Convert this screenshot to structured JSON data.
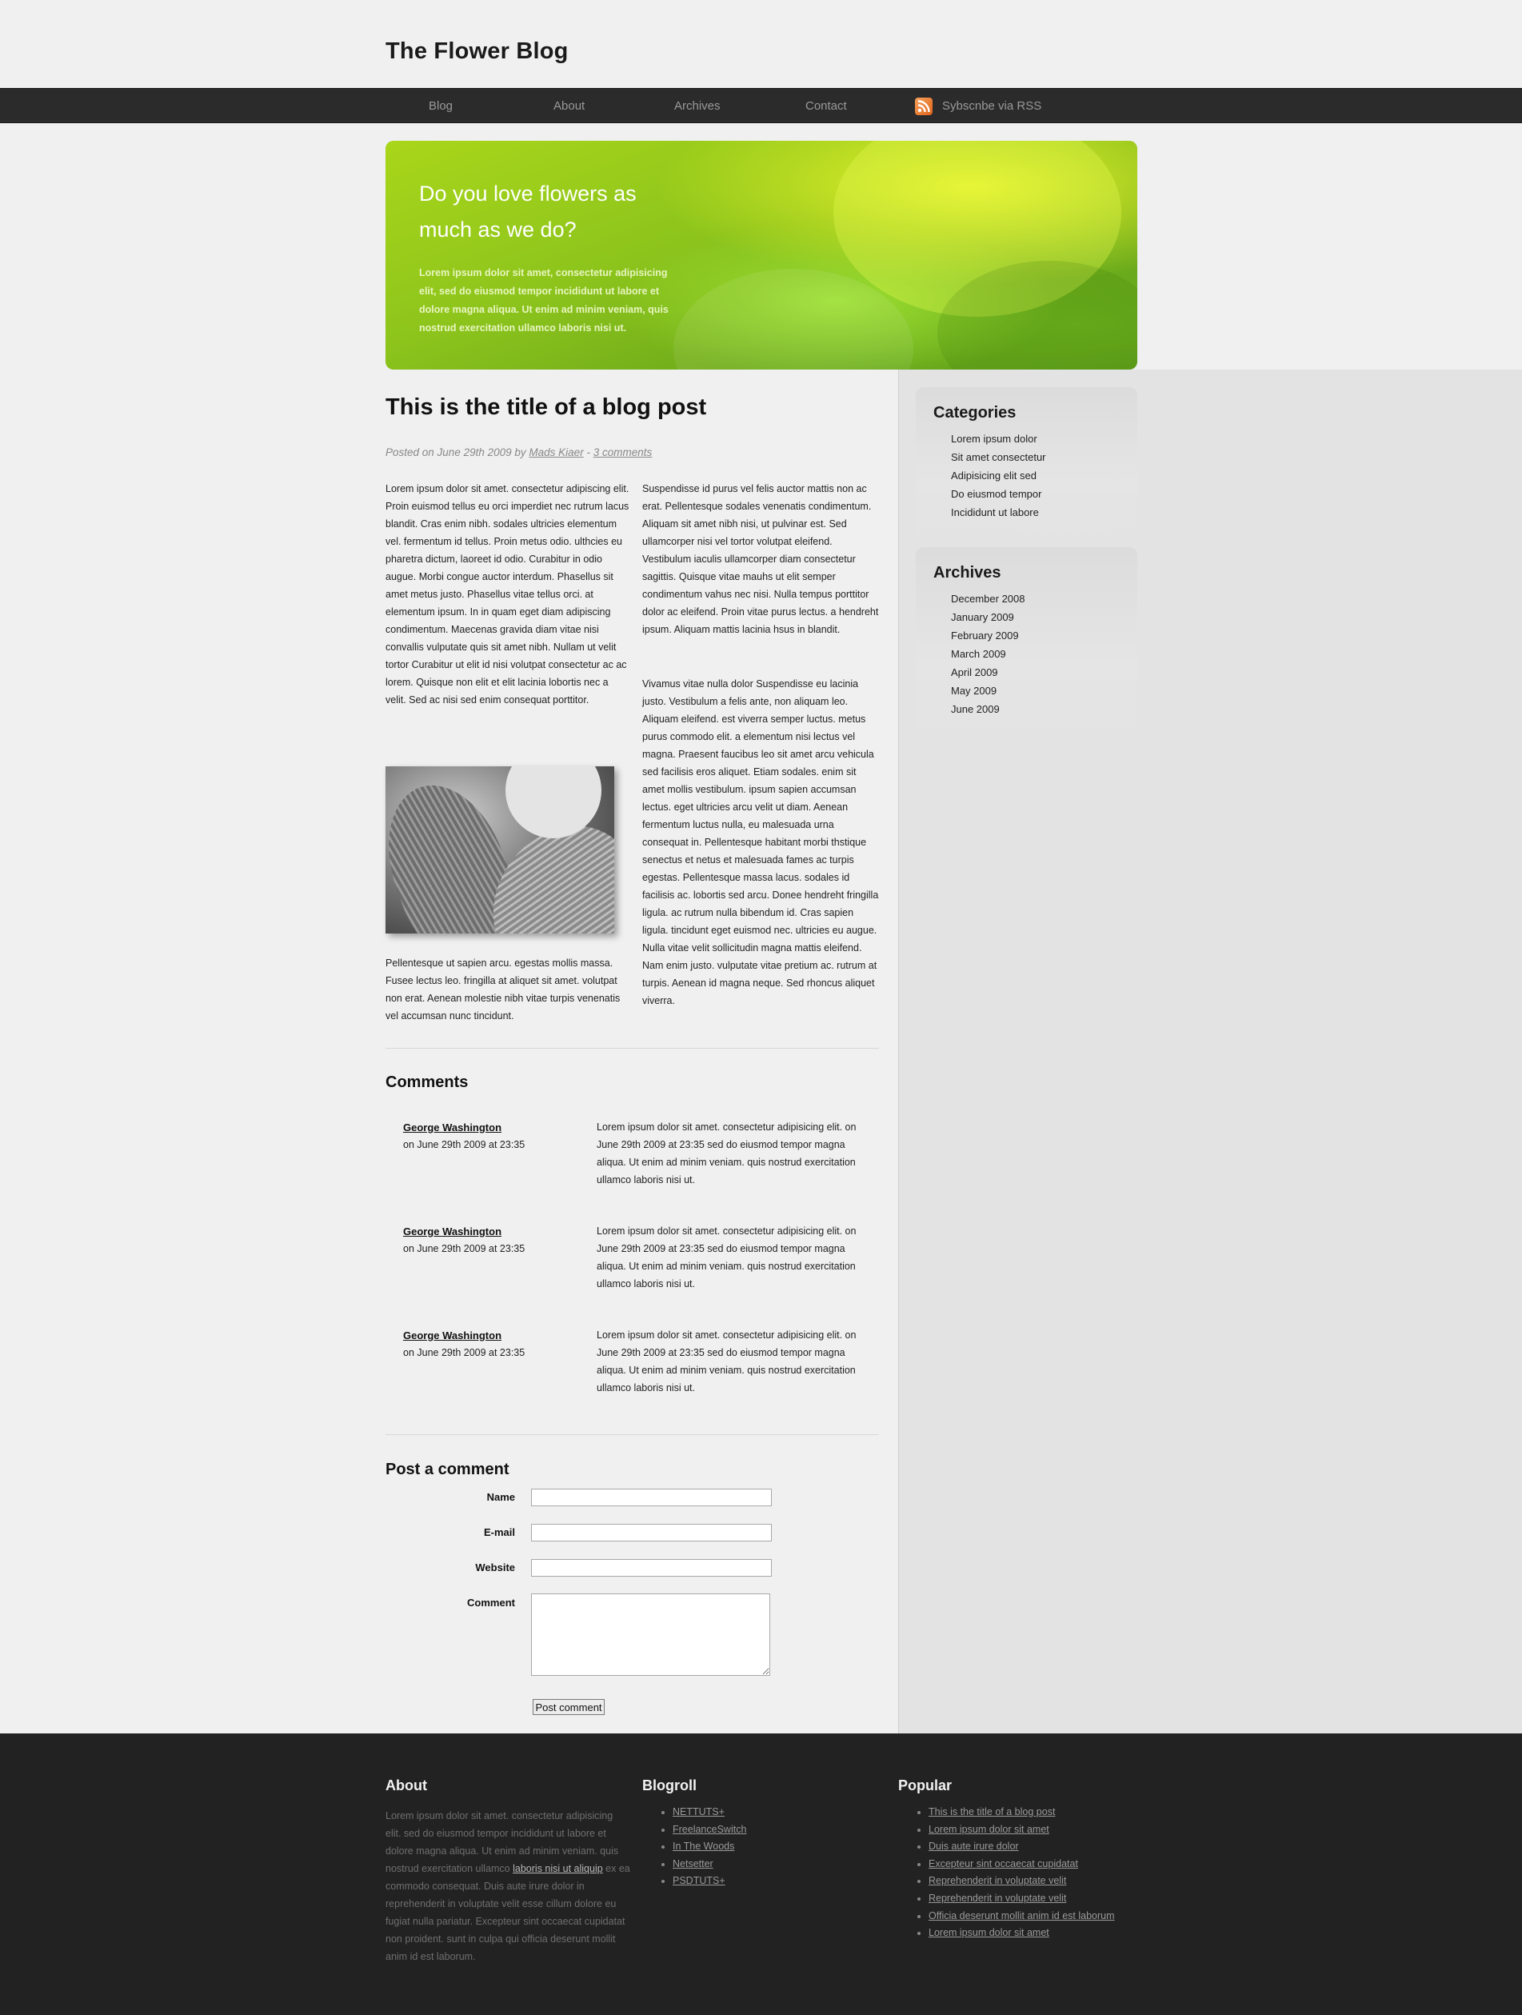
{
  "site": {
    "title": "The Flower Blog"
  },
  "nav": {
    "items": [
      "Blog",
      "About",
      "Archives",
      "Contact"
    ],
    "rss_label": "Sybscnbe via RSS"
  },
  "hero": {
    "title": "Do you love flowers as much as we do?",
    "text": "Lorem ipsum dolor sit amet, consectetur adipisicing elit, sed do eiusmod tempor incididunt ut labore et dolore magna aliqua. Ut enim ad minim veniam, quis nostrud exercitation ullamco laboris nisi ut."
  },
  "post": {
    "title": "This is the title of a blog post",
    "meta_prefix": "Posted on June 29th 2009 by",
    "author": "Mads Kiaer",
    "meta_sep": "-",
    "comments_link": "3 comments",
    "col1_p1": "Lorem ipsum dolor sit amet. consectetur adipiscing elit. Proin euismod tellus eu orci imperdiet nec rutrum lacus blandit. Cras enim nibh. sodales ultricies elementum vel. fermentum id tellus. Proin metus odio. ulthcies eu pharetra dictum, laoreet id odio. Curabitur in odio augue. Morbi congue auctor interdum. Phasellus sit amet metus justo. Phasellus vitae tellus orci. at elementum ipsum. In in quam eget diam adipiscing condimentum. Maecenas gravida diam vitae nisi convallis vulputate quis sit amet nibh. Nullam ut velit tortor Curabitur ut elit id nisi volutpat consectetur ac ac lorem. Quisque non elit et elit lacinia lobortis nec a velit. Sed ac nisi sed enim consequat porttitor.",
    "col1_p2": "Pellentesque ut sapien arcu. egestas mollis massa. Fusee lectus leo. fringilla at aliquet sit amet. volutpat non erat. Aenean molestie nibh vitae turpis venenatis vel accumsan nunc tincidunt.",
    "col2_p1": "Suspendisse id purus vel felis auctor mattis non ac erat. Pellentesque sodales venenatis condimentum. Aliquam sit amet nibh nisi, ut pulvinar est. Sed ullamcorper nisi vel tortor volutpat eleifend. Vestibulum iaculis ullamcorper diam consectetur sagittis. Quisque vitae mauhs ut elit semper condimentum vahus nec nisi. Nulla tempus porttitor dolor ac eleifend. Proin vitae purus lectus. a hendreht ipsum. Aliquam mattis lacinia hsus in blandit.",
    "col2_p2": "Vivamus vitae nulla dolor Suspendisse eu lacinia justo. Vestibulum a felis ante, non aliquam leo. Aliquam eleifend. est viverra semper luctus. metus purus commodo elit. a elementum nisi lectus vel magna. Praesent faucibus leo sit amet arcu vehicula sed facilisis eros aliquet. Etiam sodales. enim sit amet mollis vestibulum. ipsum sapien accumsan lectus. eget ultricies arcu velit ut diam. Aenean fermentum luctus nulla, eu malesuada urna consequat in. Pellentesque habitant morbi thstique senectus et netus et malesuada fames ac turpis egestas. Pellentesque massa lacus. sodales id facilisis ac. lobortis sed arcu. Donee hendreht fringilla ligula. ac rutrum nulla bibendum id. Cras sapien ligula. tincidunt eget euismod nec. ultricies eu augue. Nulla vitae velit sollicitudin magna mattis eleifend. Nam enim justo. vulputate vitae pretium ac. rutrum at turpis. Aenean id magna neque. Sed rhoncus aliquet viverra."
  },
  "comments": {
    "title": "Comments",
    "items": [
      {
        "author": "George Washington",
        "date": "on June 29th 2009 at 23:35",
        "body": "Lorem ipsum dolor sit amet. consectetur adipisicing elit. on June 29th 2009 at 23:35 sed do eiusmod tempor magna aliqua. Ut enim ad minim veniam. quis nostrud exercitation ullamco laboris nisi ut."
      },
      {
        "author": "George Washington",
        "date": "on June 29th 2009 at 23:35",
        "body": "Lorem ipsum dolor sit amet. consectetur adipisicing elit. on June 29th 2009 at 23:35 sed do eiusmod tempor magna aliqua. Ut enim ad minim veniam. quis nostrud exercitation ullamco laboris nisi ut."
      },
      {
        "author": "George Washington",
        "date": "on June 29th 2009 at 23:35",
        "body": "Lorem ipsum dolor sit amet. consectetur adipisicing elit. on June 29th 2009 at 23:35 sed do eiusmod tempor magna aliqua. Ut enim ad minim veniam. quis nostrud exercitation ullamco laboris nisi ut."
      }
    ]
  },
  "form": {
    "title": "Post a comment",
    "name_label": "Name",
    "email_label": "E-mail",
    "website_label": "Website",
    "comment_label": "Comment",
    "submit_label": "Post comment"
  },
  "sidebar": {
    "categories": {
      "title": "Categories",
      "items": [
        "Lorem ipsum dolor",
        "Sit amet consectetur",
        "Adipisicing elit sed",
        "Do eiusmod tempor",
        "Incididunt ut labore"
      ]
    },
    "archives": {
      "title": "Archives",
      "items": [
        "December 2008",
        "January 2009",
        "February 2009",
        "March 2009",
        "April 2009",
        "May 2009",
        "June 2009"
      ]
    }
  },
  "footer": {
    "about": {
      "title": "About",
      "text_before": "Lorem ipsum dolor sit amet. consectetur adipisicing elit. sed do eiusmod tempor incididunt ut labore et dolore magna aliqua. Ut enim ad minim veniam. quis nostrud exercitation ullamco",
      "link": "laboris nisi ut aliquip",
      "text_after": "ex ea commodo consequat. Duis aute irure dolor in reprehenderit in voluptate velit esse cillum dolore eu fugiat nulla pariatur. Excepteur sint occaecat cupidatat non proident. sunt in culpa qui officia deserunt mollit anim id est laborum."
    },
    "blogroll": {
      "title": "Blogroll",
      "items": [
        "NETTUTS+",
        "FreelanceSwitch",
        "In The Woods",
        "Netsetter",
        "PSDTUTS+"
      ]
    },
    "popular": {
      "title": "Popular",
      "items": [
        "This is the title of a blog post",
        "Lorem ipsum dolor sit amet",
        "Duis aute irure dolor",
        "Excepteur sint occaecat cupidatat",
        "Reprehenderit in voluptate velit",
        "Reprehenderit in voluptate velit",
        "Officia deserunt mollit anim id est laborum",
        "Lorem ipsum dolor sit amet"
      ]
    }
  }
}
